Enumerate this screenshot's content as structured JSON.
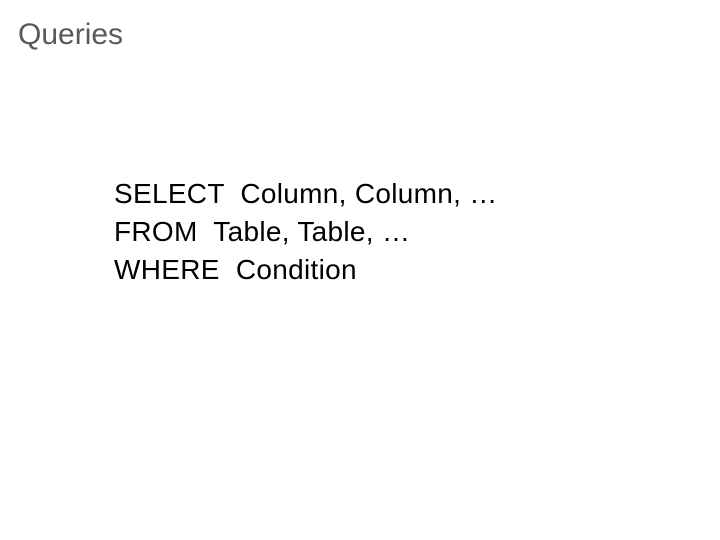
{
  "title": "Queries",
  "lines": {
    "line1": "SELECT  Column, Column, …",
    "line2": "FROM  Table, Table, …",
    "line3": "WHERE  Condition"
  }
}
